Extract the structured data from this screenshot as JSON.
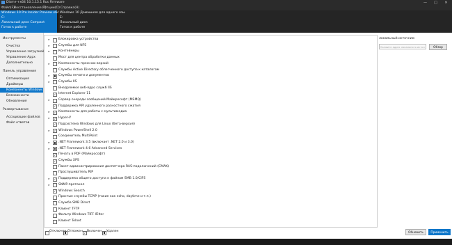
{
  "window": {
    "title": "Dism++x64 10.1.15.1 Rus Firmware",
    "controls": [
      "—",
      "□",
      "✕"
    ]
  },
  "menu": [
    "Файл(F)",
    "Восстановление(R)",
    "Опции(O)",
    "Справка(H)"
  ],
  "images": [
    {
      "line1": "Windows 10 Pro Insider Preview x64",
      "line2": "C:",
      "line3": "Локальный диск Compact",
      "line4": "Готов к работе"
    },
    {
      "line1": "Windows 10 Домашняя для одного язы",
      "line2": "E:",
      "line3": "Локальный диск",
      "line4": "Готов к работе"
    }
  ],
  "sidebar": {
    "groups": [
      {
        "header": "Инструменты",
        "items": [
          "Очистка",
          "Управление загрузкой",
          "Управление Appx",
          "Дополнительно"
        ]
      },
      {
        "header": "Панель управления",
        "items": [
          "Оптимизация",
          "Драйверы",
          "Компоненты Windows",
          "Возможности",
          "Обновления"
        ]
      },
      {
        "header": "Развертывание",
        "items": [
          "Ассоциации файлов",
          "Файл ответов"
        ]
      }
    ],
    "active": "Компоненты Windows"
  },
  "features": [
    {
      "indent": 0,
      "expander": "▸",
      "check": "none",
      "label": "Блокировка устройства"
    },
    {
      "indent": 0,
      "expander": "▸",
      "check": "none",
      "label": "Службы для NFS"
    },
    {
      "indent": 0,
      "expander": "▸",
      "check": "none",
      "label": "Контейнеры"
    },
    {
      "indent": 0,
      "expander": "",
      "check": "none",
      "label": "Мост для центра обработки данных"
    },
    {
      "indent": 0,
      "expander": "▸",
      "check": "none",
      "label": "Компоненты прежних версий"
    },
    {
      "indent": 0,
      "expander": "",
      "check": "none",
      "label": "Службы Active Directory облегченного доступа к каталогам"
    },
    {
      "indent": 0,
      "expander": "▸",
      "check": "partial",
      "label": "Службы печати и документов"
    },
    {
      "indent": 0,
      "expander": "▸",
      "check": "none",
      "label": "Службы IIS"
    },
    {
      "indent": 0,
      "expander": "",
      "check": "none",
      "label": "Внедряемое веб-ядро служб IIS"
    },
    {
      "indent": 0,
      "expander": "",
      "check": "checked",
      "label": "Internet Explorer 11"
    },
    {
      "indent": 0,
      "expander": "▸",
      "check": "none",
      "label": "Сервер очереди сообщений Майкрософт (MSMQ)"
    },
    {
      "indent": 0,
      "expander": "",
      "check": "checked",
      "label": "Поддержка API удаленного разностного сжатия"
    },
    {
      "indent": 0,
      "expander": "▸",
      "check": "checked",
      "label": "Компоненты для работы с мультимедиа"
    },
    {
      "indent": 0,
      "expander": "▸",
      "check": "checked",
      "label": "Hyper-V"
    },
    {
      "indent": 0,
      "expander": "",
      "check": "checked",
      "label": "Подсистема Windows для Linux (бета-версия)"
    },
    {
      "indent": 0,
      "expander": "▸",
      "check": "checked",
      "label": "Windows PowerShell 2.0"
    },
    {
      "indent": 0,
      "expander": "",
      "check": "none",
      "label": "Соединитель MultiPoint"
    },
    {
      "indent": 0,
      "expander": "▸",
      "check": "partial",
      "label": ".NET Framework 3.5 (включает .NET 2.0 и 3.0)"
    },
    {
      "indent": 0,
      "expander": "▸",
      "check": "partial",
      "label": ".NET Framework 4.6 Advanced Services"
    },
    {
      "indent": 0,
      "expander": "",
      "check": "checked",
      "label": "Печать в PDF (Майкрософт)"
    },
    {
      "indent": 0,
      "expander": "",
      "check": "checked",
      "label": "Службы XPS"
    },
    {
      "indent": 0,
      "expander": "",
      "check": "none",
      "label": "Пакет администрирования диспетчера RAS-подключений (CMAK)"
    },
    {
      "indent": 0,
      "expander": "",
      "check": "none",
      "label": "Прослушиватель RIP"
    },
    {
      "indent": 0,
      "expander": "▸",
      "check": "checked",
      "label": "Поддержка общего доступа к файлам SMB 1.0/CIFS"
    },
    {
      "indent": 0,
      "expander": "▸",
      "check": "none",
      "label": "SNMP-протокол"
    },
    {
      "indent": 0,
      "expander": "",
      "check": "checked",
      "label": "Windows Search"
    },
    {
      "indent": 0,
      "expander": "",
      "check": "none",
      "label": "Простые службы TCPIP (такие как echo, daytime и т.п.)"
    },
    {
      "indent": 0,
      "expander": "",
      "check": "none",
      "label": "Служба SMB Direct"
    },
    {
      "indent": 0,
      "expander": "",
      "check": "none",
      "label": "Клиент TFTP"
    },
    {
      "indent": 0,
      "expander": "",
      "check": "none",
      "label": "Фильтр Windows TIFF IFilter"
    },
    {
      "indent": 0,
      "expander": "",
      "check": "none",
      "label": "Клиент Telnet"
    }
  ],
  "source": {
    "label": "локальный источник:",
    "placeholder": "Укажите адрес локального источ",
    "browse": "Обзор"
  },
  "legend": [
    {
      "check": "none",
      "label": "Отключен"
    },
    {
      "check": "partial",
      "label": "Отложен"
    },
    {
      "check": "checked",
      "label": "Включен"
    },
    {
      "check": "partial",
      "label": "Удален"
    }
  ],
  "buttons": {
    "refresh": "Обновить",
    "apply": "Применить"
  }
}
